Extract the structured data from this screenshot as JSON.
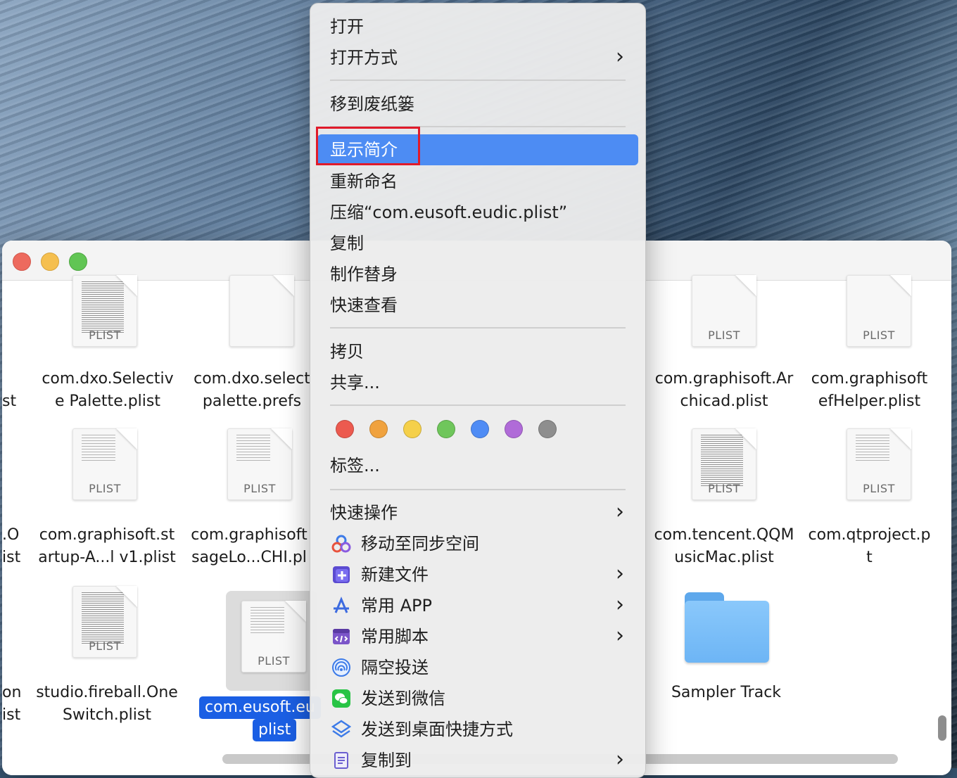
{
  "window": {
    "files": [
      {
        "id": "f1",
        "line1": "com.dxo.Selectiv",
        "line2": "e Palette.plist",
        "kind": "PLIST"
      },
      {
        "id": "f2",
        "line1": "com.dxo.select",
        "line2": "palette.prefs",
        "kind": ""
      },
      {
        "id": "f3",
        "line1": "com.graphisoft.Ar",
        "line2": "chicad.plist",
        "kind": "PLIST"
      },
      {
        "id": "f4",
        "line1": "com.graphisoft",
        "line2": "efHelper.plist",
        "kind": "PLIST"
      },
      {
        "id": "f5",
        "line1": "com.graphisoft.st",
        "line2": "artup-A...l v1.plist",
        "kind": "PLIST"
      },
      {
        "id": "f6",
        "line1": "com.graphisoft",
        "line2": "sageLo...CHI.pl",
        "kind": "PLIST"
      },
      {
        "id": "f7",
        "line1": "com.tencent.QQM",
        "line2": "usicMac.plist",
        "kind": "PLIST"
      },
      {
        "id": "f8",
        "line1": "com.qtproject.p",
        "line2": "t",
        "kind": "PLIST"
      },
      {
        "id": "f9",
        "line1": "studio.fireball.One",
        "line2": "Switch.plist",
        "kind": "PLIST"
      },
      {
        "id": "f10",
        "line1": "com.eusoft.eu",
        "line2": "plist",
        "kind": "PLIST"
      },
      {
        "id": "f11",
        "line1": "Sampler Track",
        "line2": "",
        "kind": ""
      }
    ],
    "partials": {
      "r1": "st",
      "r2a": ".O",
      "r2b": "ist",
      "r3a": "on",
      "r3b": "ist"
    }
  },
  "menu": {
    "items": [
      {
        "label": "打开"
      },
      {
        "label": "打开方式",
        "chevron": "›"
      },
      {
        "label": "移到废纸篓"
      },
      {
        "label": "显示简介"
      },
      {
        "label": "重新命名"
      },
      {
        "label": "压缩“com.eusoft.eudic.plist”"
      },
      {
        "label": "复制"
      },
      {
        "label": "制作替身"
      },
      {
        "label": "快速查看"
      },
      {
        "label": "拷贝"
      },
      {
        "label": "共享..."
      },
      {
        "label": "标签..."
      },
      {
        "label": "快速操作",
        "chevron": "›"
      },
      {
        "label": "移动至同步空间",
        "icon": "sync-space-icon"
      },
      {
        "label": "新建文件",
        "chevron": "›",
        "icon": "new-file-icon"
      },
      {
        "label": "常用 APP",
        "chevron": "›",
        "icon": "app-store-icon"
      },
      {
        "label": "常用脚本",
        "chevron": "›",
        "icon": "script-icon"
      },
      {
        "label": "隔空投送",
        "icon": "airdrop-icon"
      },
      {
        "label": "发送到微信",
        "icon": "wechat-icon"
      },
      {
        "label": "发送到桌面快捷方式",
        "icon": "shortcut-icon"
      },
      {
        "label": "复制到",
        "chevron": "›",
        "icon": "copy-to-icon"
      }
    ],
    "tag_colors": [
      "#ec5a4f",
      "#f0a23e",
      "#f5d04a",
      "#6fc65b",
      "#4f8cf5",
      "#b06bd8",
      "#8e8e8e"
    ],
    "highlight_color": "#4d8cf3"
  }
}
